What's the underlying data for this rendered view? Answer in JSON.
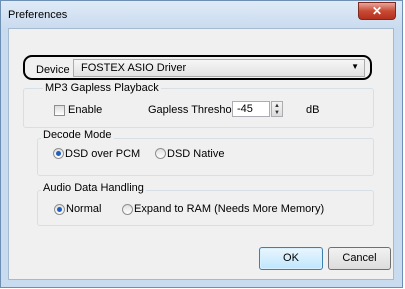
{
  "window": {
    "title": "Preferences",
    "close_glyph": "✕"
  },
  "device": {
    "label": "Device",
    "value": "FOSTEX ASIO Driver",
    "arrow": "▼"
  },
  "mp3": {
    "legend": "MP3 Gapless Playback",
    "enable_label": "Enable",
    "threshold_label": "Gapless Threshold",
    "threshold_value": "-45",
    "unit": "dB"
  },
  "decode": {
    "legend": "Decode Mode",
    "options": [
      "DSD over PCM",
      "DSD Native"
    ],
    "selected": "DSD over PCM"
  },
  "audio": {
    "legend": "Audio Data Handling",
    "options": [
      "Normal",
      "Expand to RAM (Needs More Memory)"
    ],
    "selected": "Normal"
  },
  "buttons": {
    "ok": "OK",
    "cancel": "Cancel"
  },
  "icons": {
    "spin_up": "▲",
    "spin_down": "▼"
  }
}
